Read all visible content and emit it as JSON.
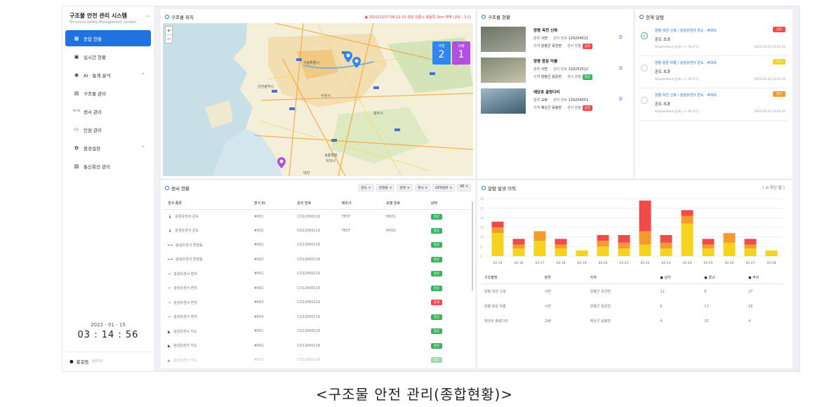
{
  "app": {
    "title": "구조물 안전 관리 시스템",
    "subtitle": "Structure Safety Management System"
  },
  "sidebar": {
    "items": [
      {
        "label": "종합 현황",
        "icon": "dashboard-icon",
        "active": true
      },
      {
        "label": "실시간 현황",
        "icon": "monitor-icon"
      },
      {
        "label": "AI · 통계 분석",
        "icon": "location-icon",
        "expandable": true
      },
      {
        "label": "구조물 관리",
        "icon": "grid-icon"
      },
      {
        "label": "센서 관리",
        "icon": "sensor-icon"
      },
      {
        "label": "인원 관리",
        "icon": "people-icon"
      },
      {
        "label": "환경설정",
        "icon": "gear-icon",
        "expandable": true
      },
      {
        "label": "통신회선 관리",
        "icon": "document-icon"
      }
    ],
    "date": "2022 - 01 - 15",
    "time": "03 : 14 : 56",
    "user": {
      "name": "홍길동",
      "role": "[관리자]"
    }
  },
  "map_panel": {
    "title": "구조물 위치",
    "warning": "2021/12/17 06:22:10 강원 강릉시 북동쪽 2km 해역 (규모 : 3.2)",
    "badges": [
      {
        "label": "사면",
        "count": "2",
        "color": "#2f86f0"
      },
      {
        "label": "교량",
        "count": "1",
        "color": "#b14fe0"
      }
    ],
    "zoom_in": "+",
    "zoom_out": "−"
  },
  "structure_panel": {
    "title": "구조물 현황",
    "items": [
      {
        "name": "양평 옥천 신복",
        "kind_label": "분류",
        "kind": "사면",
        "mgmt_label": "관리 번호",
        "mgmt_no": "120254521",
        "region_label": "지역",
        "region": "양평군 옥천면",
        "sensor_label": "센서 현황",
        "status": "심각",
        "status_color": "#ef4b4b"
      },
      {
        "name": "양평 용문 마룡",
        "kind_label": "분류",
        "kind": "사면",
        "mgmt_label": "관리 번호",
        "mgmt_no": "120252512",
        "region_label": "지역",
        "region": "양평군 용문면",
        "sensor_label": "센서 현황",
        "status": "정상",
        "status_color": "#3cb25f"
      },
      {
        "name": "예당호 출렁다리",
        "kind_label": "분류",
        "kind": "교량",
        "mgmt_label": "관리 번호",
        "mgmt_no": "130254551",
        "region_label": "지역",
        "region": "예산군 응봉면",
        "sensor_label": "센서 현황",
        "status": "심각",
        "status_color": "#ef4b4b"
      }
    ]
  },
  "alarm_panel": {
    "title": "현재 알람",
    "items": [
      {
        "title": "양평 옥천 신복 / 광섬유센서 온도 - #001",
        "level": "심각",
        "level_color": "#ef4b4b",
        "message": "온도 초과",
        "detail": "temperature [임계 => 16.4°C]",
        "time": "2022-03-24 13:02:43",
        "checked": true
      },
      {
        "title": "양평 용문 마룡 / 광섬유센서 온도 - #001",
        "level": "주의",
        "level_color": "#f5d31e",
        "message": "온도 초과",
        "detail": "temperature [임계 => 16.4°C]",
        "time": "2022-03-24 13:02:43",
        "checked": false
      },
      {
        "title": "양평 옥천 신복 / 광섬유센서 온도 - #001",
        "level": "경고",
        "level_color": "#f59a2e",
        "message": "온도 초과",
        "detail": "temperature [임계 => 16.4°C]",
        "time": "2022-03-24 13:02:43",
        "checked": false
      }
    ]
  },
  "sensor_panel": {
    "title": "센서 현황",
    "filters": [
      "온도 ×",
      "변형률 ×",
      "변위 ×",
      "경사 ×",
      "GPS변위 ×",
      "AE ×"
    ],
    "columns": [
      "센서 종류",
      "센서 ID",
      "관리 번호",
      "제조사",
      "모델 번호",
      "상태"
    ],
    "rows": [
      {
        "icon": "🌡",
        "type": "광섬유센서 온도",
        "id": "#001",
        "mgmt": "CO12000119",
        "maker": "TEST",
        "model": "M001",
        "status": "정상",
        "status_color": "#3cb25f"
      },
      {
        "icon": "🌡",
        "type": "광섬유센서 온도",
        "id": "#002",
        "mgmt": "CO12000119",
        "maker": "TEST",
        "model": "M002",
        "status": "정상",
        "status_color": "#3cb25f"
      },
      {
        "icon": "⟷",
        "type": "광섬유센서 변형률",
        "id": "#001",
        "mgmt": "CO12000119",
        "maker": "",
        "model": "",
        "status": "정상",
        "status_color": "#3cb25f"
      },
      {
        "icon": "⟷",
        "type": "광섬유센서 변형률",
        "id": "#002",
        "mgmt": "CO12000119",
        "maker": "",
        "model": "",
        "status": "정상",
        "status_color": "#3cb25f"
      },
      {
        "icon": "⇀",
        "type": "광섬유센서 변위",
        "id": "#001",
        "mgmt": "CO12000119",
        "maker": "",
        "model": "",
        "status": "정상",
        "status_color": "#3cb25f"
      },
      {
        "icon": "⇀",
        "type": "광섬유센서 변위",
        "id": "#002",
        "mgmt": "CO12000119",
        "maker": "",
        "model": "",
        "status": "정상",
        "status_color": "#3cb25f"
      },
      {
        "icon": "⇀",
        "type": "광섬유센서 변위",
        "id": "#003",
        "mgmt": "CO12000119",
        "maker": "",
        "model": "",
        "status": "장애",
        "status_color": "#ef4b4b"
      },
      {
        "icon": "⇀",
        "type": "광섬유센서 변위",
        "id": "#004",
        "mgmt": "CO12000119",
        "maker": "",
        "model": "",
        "status": "정상",
        "status_color": "#3cb25f"
      },
      {
        "icon": "◣",
        "type": "광섬유센서 각도",
        "id": "#001",
        "mgmt": "CO12000119",
        "maker": "",
        "model": "",
        "status": "정상",
        "status_color": "#3cb25f"
      },
      {
        "icon": "◣",
        "type": "광섬유센서 각도",
        "id": "#002",
        "mgmt": "CO12000119",
        "maker": "",
        "model": "",
        "status": "정상",
        "status_color": "#3cb25f"
      },
      {
        "icon": "◣",
        "type": "광섬유센서 각도",
        "id": "#003",
        "mgmt": "CO12000119",
        "maker": "",
        "model": "",
        "status": "정상",
        "status_color": "#3cb25f"
      }
    ]
  },
  "history_panel": {
    "title": "알람 발생 이력",
    "nav_label": "〈  ⊙ 지난 달  〉",
    "columns": [
      "구조물명",
      "분류",
      "지역",
      "● 심각",
      "● 경고",
      "● 주의"
    ],
    "rows": [
      {
        "name": "양평 옥천 신복",
        "kind": "사면",
        "region": "양평군 옥천면",
        "severe": "12",
        "warning": "8",
        "caution": "27"
      },
      {
        "name": "양평 용문 마룡",
        "kind": "사면",
        "region": "양평군 용문면",
        "severe": "6",
        "warning": "11",
        "caution": "16"
      },
      {
        "name": "예당호 출렁다리",
        "kind": "교량",
        "region": "예산군 응봉면",
        "severe": "4",
        "warning": "15",
        "caution": "4"
      }
    ]
  },
  "chart_data": {
    "type": "bar",
    "stacked": true,
    "categories": [
      "02-15",
      "02-16",
      "02-17",
      "02-18",
      "02-19",
      "02-20",
      "02-21",
      "02-22",
      "02-23",
      "02-24",
      "02-25",
      "02-26",
      "02-27",
      "02-28"
    ],
    "series": [
      {
        "name": "주의",
        "color": "#f5d31e",
        "values": [
          12,
          4,
          8,
          4,
          3,
          5,
          4,
          6,
          4,
          17,
          4,
          7,
          4,
          3
        ]
      },
      {
        "name": "경고",
        "color": "#f59a2e",
        "values": [
          3,
          2,
          5,
          2,
          0,
          3,
          3,
          7,
          3,
          4,
          2,
          5,
          2,
          0
        ]
      },
      {
        "name": "심각",
        "color": "#ef4b4b",
        "values": [
          3,
          3,
          0,
          3,
          0,
          3,
          4,
          16,
          4,
          3,
          3,
          0,
          3,
          0
        ]
      }
    ],
    "ylim": [
      0,
      30
    ],
    "yticks": [
      0,
      5,
      10,
      15,
      20,
      25,
      30
    ],
    "grid": true
  },
  "caption": "<구조물 안전 관리(종합현황)>"
}
